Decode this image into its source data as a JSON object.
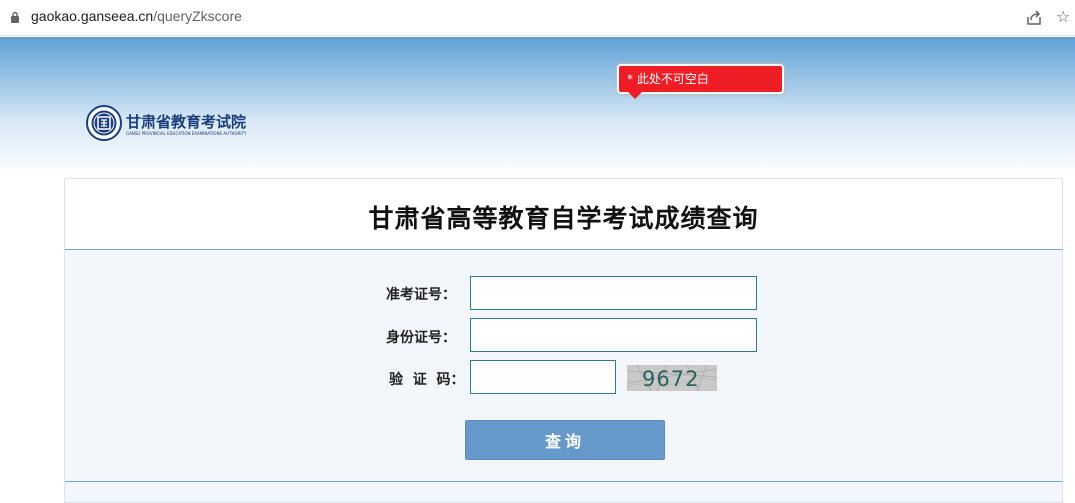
{
  "browser": {
    "url_host": "gaokao.ganseea.cn",
    "url_path": "/queryZkscore"
  },
  "header": {
    "org_name": "甘肃省教育考试院",
    "org_subtitle": "GANSU PROVINCIAL EDUCATION EXAMINATIONS AUTHORITY"
  },
  "main": {
    "title": "甘肃省高等教育自学考试成绩查询"
  },
  "form": {
    "exam_no_label": "准考证号：",
    "exam_no_value": "",
    "id_label": "身份证号：",
    "id_value": "",
    "captcha_label": "验  证  码：",
    "captcha_value": "",
    "captcha_image_text": "9672",
    "submit_label": "查询"
  },
  "validation": {
    "message": "* 此处不可空白"
  },
  "colors": {
    "accent_blue": "#6699c9",
    "tooltip_red": "#ee1c24",
    "field_border": "#2e7d8c"
  }
}
